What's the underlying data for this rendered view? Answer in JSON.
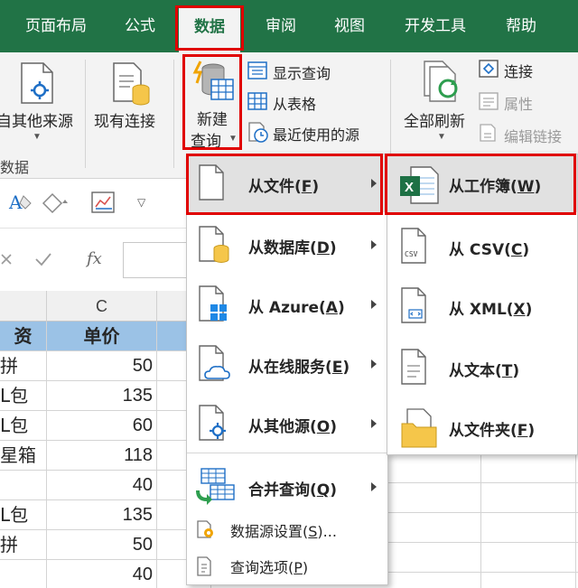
{
  "ribbon_tabs": {
    "layout": "页面布局",
    "formulas": "公式",
    "data": "数据",
    "review": "审阅",
    "view": "视图",
    "developer": "开发工具",
    "help": "帮助"
  },
  "ribbon": {
    "other_sources": "自其他来源",
    "existing_connections": "现有连接",
    "new_query_line1": "新建",
    "new_query_line2": "查询",
    "show_queries": "显示查询",
    "from_table": "从表格",
    "recent_sources": "最近使用的源",
    "refresh_all": "全部刷新",
    "connections": "连接",
    "properties": "属性",
    "edit_links": "编辑链接",
    "group_label": "数据"
  },
  "formula_bar": {
    "fx": "fx"
  },
  "grid": {
    "column_c": "C",
    "header_left": "资",
    "header_c": "单价",
    "rows": [
      {
        "left": "拼",
        "price": "50"
      },
      {
        "left": "L包",
        "price": "135"
      },
      {
        "left": "L包",
        "price": "60"
      },
      {
        "left": "星箱",
        "price": "118"
      },
      {
        "left": "",
        "price": "40"
      },
      {
        "left": "L包",
        "price": "135"
      },
      {
        "left": "拼",
        "price": "50"
      },
      {
        "left": "",
        "price": "40"
      }
    ]
  },
  "new_query_menu": {
    "items": [
      {
        "text": "从文件(",
        "key": "F",
        "end": ")"
      },
      {
        "text": "从数据库(",
        "key": "D",
        "end": ")"
      },
      {
        "text": "从 Azure(",
        "key": "A",
        "end": ")"
      },
      {
        "text": "从在线服务(",
        "key": "E",
        "end": ")"
      },
      {
        "text": "从其他源(",
        "key": "O",
        "end": ")"
      },
      {
        "text": "合并查询(",
        "key": "Q",
        "end": ")"
      }
    ],
    "data_source_settings": {
      "text": "数据源设置(",
      "key": "S",
      "end": ")..."
    },
    "query_options": {
      "text": "查询选项(",
      "key": "P",
      "end": ")"
    }
  },
  "from_file_menu": {
    "items": [
      {
        "text": "从工作簿(",
        "key": "W",
        "end": ")"
      },
      {
        "text": "从 CSV(",
        "key": "C",
        "end": ")"
      },
      {
        "text": "从 XML(",
        "key": "X",
        "end": ")"
      },
      {
        "text": "从文本(",
        "key": "T",
        "end": ")"
      },
      {
        "text": "从文件夹(",
        "key": "F",
        "end": ")"
      }
    ]
  },
  "icons": {
    "excel_badge_text": "X",
    "csv_text": "CSV"
  },
  "colors": {
    "ribbon_green": "#217346",
    "highlight_red": "#e00000",
    "header_blue": "#9bc2e6"
  }
}
